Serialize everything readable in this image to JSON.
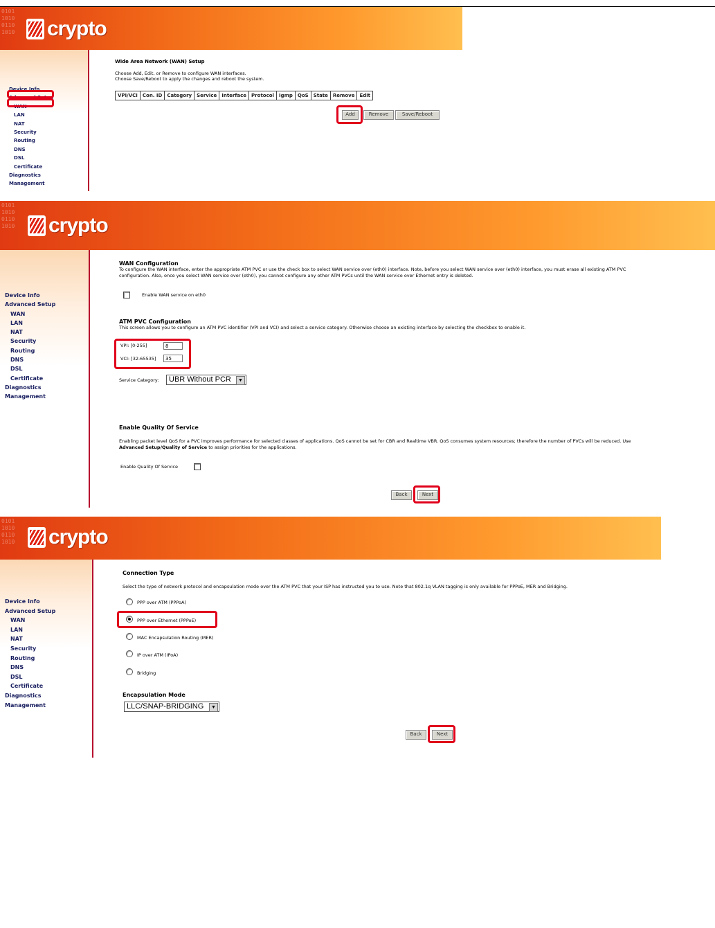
{
  "brand": {
    "logo_text": "crypto",
    "banner_binary": "0101\n1010\n0110\n1010"
  },
  "menu": {
    "device_info": "Device Info",
    "advanced_setup": "Advanced Setup",
    "wan": "WAN",
    "lan": "LAN",
    "nat": "NAT",
    "security": "Security",
    "routing": "Routing",
    "dns": "DNS",
    "dsl": "DSL",
    "certificate": "Certificate",
    "diagnostics": "Diagnostics",
    "management": "Management"
  },
  "step1": {
    "title": "Wide Area Network (WAN) Setup",
    "line1": "Choose Add, Edit, or Remove to configure WAN interfaces.",
    "line2": "Choose Save/Reboot to apply the changes and reboot the system.",
    "columns": [
      "VPI/VCI",
      "Con. ID",
      "Category",
      "Service",
      "Interface",
      "Protocol",
      "Igmp",
      "QoS",
      "State",
      "Remove",
      "Edit"
    ],
    "add_label": "Add",
    "remove_label": "Remove",
    "save_reboot_label": "Save/Reboot"
  },
  "step2": {
    "wan_config_title": "WAN Configuration",
    "wan_config_text1": "To configure the WAN interface, enter the appropriate ATM PVC or use the check box to select WAN service over (eth0) interface. Note, before you select WAN service over (eth0) interface, you must erase all existing ATM PVC",
    "wan_config_text2": "configuration. Also, once you select WAN service over (eth0), you cannot configure any other ATM PVCs until the WAN service over Ethernet entry is deleted.",
    "enable_eth0_label": "Enable WAN service on eth0",
    "atm_title": "ATM PVC Configuration",
    "atm_text": "This screen allows you to configure an ATM PVC identifier (VPI and VCI) and select a service category. Otherwise choose an existing interface by selecting the checkbox to enable it.",
    "vpi_label": "VPI: [0-255]",
    "vpi_value": "8",
    "vci_label": "VCI: [32-65535]",
    "vci_value": "35",
    "service_category_label": "Service Category:",
    "service_category_value": "UBR Without PCR",
    "qos_title": "Enable Quality Of Service",
    "qos_text1": "Enabling packet level QoS for a PVC improves performance for selected classes of applications.  QoS cannot be set for CBR and Realtime VBR.  QoS consumes system resources; therefore the number of PVCs will be reduced. Use",
    "qos_text2_bold": "Advanced Setup/Quality of Service",
    "qos_text2_rest": " to assign priorities for the applications.",
    "enable_qos_label": "Enable Quality Of Service",
    "back_label": "Back",
    "next_label": "Next"
  },
  "step3": {
    "title": "Connection Type",
    "description": "Select the type of network protocol and encapsulation mode over the ATM PVC that your ISP has instructed you to use. Note that 802.1q VLAN tagging is only available for PPPoE, MER and Bridging.",
    "options": [
      "PPP over ATM (PPPoA)",
      "PPP over Ethernet (PPPoE)",
      "MAC Encapsulation Routing (MER)",
      "IP over ATM (IPoA)",
      "Bridging"
    ],
    "selected_option": "PPP over Ethernet (PPPoE)",
    "encap_title": "Encapsulation Mode",
    "encap_value": "LLC/SNAP-BRIDGING",
    "back_label": "Back",
    "next_label": "Next"
  },
  "colors": {
    "highlight": "#e0001a",
    "menu_text": "#1a2060",
    "sidebar_border": "#b60f2e"
  }
}
